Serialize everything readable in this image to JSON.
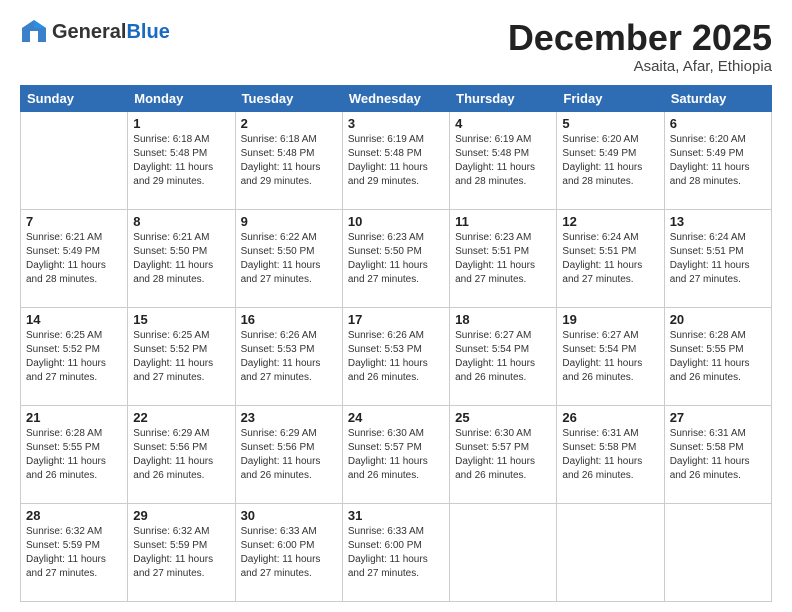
{
  "header": {
    "logo_general": "General",
    "logo_blue": "Blue",
    "month_title": "December 2025",
    "location": "Asaita, Afar, Ethiopia"
  },
  "days_of_week": [
    "Sunday",
    "Monday",
    "Tuesday",
    "Wednesday",
    "Thursday",
    "Friday",
    "Saturday"
  ],
  "weeks": [
    [
      {
        "day": "",
        "info": ""
      },
      {
        "day": "1",
        "info": "Sunrise: 6:18 AM\nSunset: 5:48 PM\nDaylight: 11 hours\nand 29 minutes."
      },
      {
        "day": "2",
        "info": "Sunrise: 6:18 AM\nSunset: 5:48 PM\nDaylight: 11 hours\nand 29 minutes."
      },
      {
        "day": "3",
        "info": "Sunrise: 6:19 AM\nSunset: 5:48 PM\nDaylight: 11 hours\nand 29 minutes."
      },
      {
        "day": "4",
        "info": "Sunrise: 6:19 AM\nSunset: 5:48 PM\nDaylight: 11 hours\nand 28 minutes."
      },
      {
        "day": "5",
        "info": "Sunrise: 6:20 AM\nSunset: 5:49 PM\nDaylight: 11 hours\nand 28 minutes."
      },
      {
        "day": "6",
        "info": "Sunrise: 6:20 AM\nSunset: 5:49 PM\nDaylight: 11 hours\nand 28 minutes."
      }
    ],
    [
      {
        "day": "7",
        "info": "Sunrise: 6:21 AM\nSunset: 5:49 PM\nDaylight: 11 hours\nand 28 minutes."
      },
      {
        "day": "8",
        "info": "Sunrise: 6:21 AM\nSunset: 5:50 PM\nDaylight: 11 hours\nand 28 minutes."
      },
      {
        "day": "9",
        "info": "Sunrise: 6:22 AM\nSunset: 5:50 PM\nDaylight: 11 hours\nand 27 minutes."
      },
      {
        "day": "10",
        "info": "Sunrise: 6:23 AM\nSunset: 5:50 PM\nDaylight: 11 hours\nand 27 minutes."
      },
      {
        "day": "11",
        "info": "Sunrise: 6:23 AM\nSunset: 5:51 PM\nDaylight: 11 hours\nand 27 minutes."
      },
      {
        "day": "12",
        "info": "Sunrise: 6:24 AM\nSunset: 5:51 PM\nDaylight: 11 hours\nand 27 minutes."
      },
      {
        "day": "13",
        "info": "Sunrise: 6:24 AM\nSunset: 5:51 PM\nDaylight: 11 hours\nand 27 minutes."
      }
    ],
    [
      {
        "day": "14",
        "info": "Sunrise: 6:25 AM\nSunset: 5:52 PM\nDaylight: 11 hours\nand 27 minutes."
      },
      {
        "day": "15",
        "info": "Sunrise: 6:25 AM\nSunset: 5:52 PM\nDaylight: 11 hours\nand 27 minutes."
      },
      {
        "day": "16",
        "info": "Sunrise: 6:26 AM\nSunset: 5:53 PM\nDaylight: 11 hours\nand 27 minutes."
      },
      {
        "day": "17",
        "info": "Sunrise: 6:26 AM\nSunset: 5:53 PM\nDaylight: 11 hours\nand 26 minutes."
      },
      {
        "day": "18",
        "info": "Sunrise: 6:27 AM\nSunset: 5:54 PM\nDaylight: 11 hours\nand 26 minutes."
      },
      {
        "day": "19",
        "info": "Sunrise: 6:27 AM\nSunset: 5:54 PM\nDaylight: 11 hours\nand 26 minutes."
      },
      {
        "day": "20",
        "info": "Sunrise: 6:28 AM\nSunset: 5:55 PM\nDaylight: 11 hours\nand 26 minutes."
      }
    ],
    [
      {
        "day": "21",
        "info": "Sunrise: 6:28 AM\nSunset: 5:55 PM\nDaylight: 11 hours\nand 26 minutes."
      },
      {
        "day": "22",
        "info": "Sunrise: 6:29 AM\nSunset: 5:56 PM\nDaylight: 11 hours\nand 26 minutes."
      },
      {
        "day": "23",
        "info": "Sunrise: 6:29 AM\nSunset: 5:56 PM\nDaylight: 11 hours\nand 26 minutes."
      },
      {
        "day": "24",
        "info": "Sunrise: 6:30 AM\nSunset: 5:57 PM\nDaylight: 11 hours\nand 26 minutes."
      },
      {
        "day": "25",
        "info": "Sunrise: 6:30 AM\nSunset: 5:57 PM\nDaylight: 11 hours\nand 26 minutes."
      },
      {
        "day": "26",
        "info": "Sunrise: 6:31 AM\nSunset: 5:58 PM\nDaylight: 11 hours\nand 26 minutes."
      },
      {
        "day": "27",
        "info": "Sunrise: 6:31 AM\nSunset: 5:58 PM\nDaylight: 11 hours\nand 26 minutes."
      }
    ],
    [
      {
        "day": "28",
        "info": "Sunrise: 6:32 AM\nSunset: 5:59 PM\nDaylight: 11 hours\nand 27 minutes."
      },
      {
        "day": "29",
        "info": "Sunrise: 6:32 AM\nSunset: 5:59 PM\nDaylight: 11 hours\nand 27 minutes."
      },
      {
        "day": "30",
        "info": "Sunrise: 6:33 AM\nSunset: 6:00 PM\nDaylight: 11 hours\nand 27 minutes."
      },
      {
        "day": "31",
        "info": "Sunrise: 6:33 AM\nSunset: 6:00 PM\nDaylight: 11 hours\nand 27 minutes."
      },
      {
        "day": "",
        "info": ""
      },
      {
        "day": "",
        "info": ""
      },
      {
        "day": "",
        "info": ""
      }
    ]
  ]
}
